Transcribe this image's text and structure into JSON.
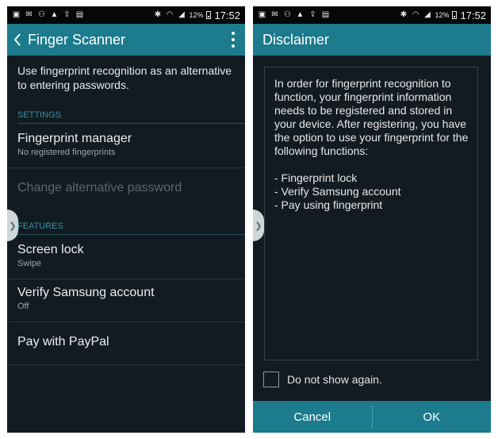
{
  "status_bar": {
    "battery": "12%",
    "time": "17:52",
    "left_icons": [
      "gallery-icon",
      "mail-icon",
      "voicemail-icon",
      "warning-icon",
      "upload-icon",
      "sim-icon"
    ],
    "right_icons": [
      "bluetooth-icon",
      "wifi-icon",
      "signal-icon",
      "battery-icon"
    ]
  },
  "left_screen": {
    "title": "Finger Scanner",
    "intro": "Use fingerprint recognition as an alternative to entering passwords.",
    "sections": [
      {
        "header": "SETTINGS"
      },
      {
        "header": "FEATURES"
      }
    ],
    "settings": [
      {
        "title": "Fingerprint manager",
        "subtitle": "No registered fingerprints"
      },
      {
        "title": "Change alternative password",
        "subtitle": ""
      }
    ],
    "features": [
      {
        "title": "Screen lock",
        "subtitle": "Swipe"
      },
      {
        "title": "Verify Samsung account",
        "subtitle": "Off"
      },
      {
        "title": "Pay with PayPal",
        "subtitle": ""
      }
    ]
  },
  "right_screen": {
    "title": "Disclaimer",
    "paragraph": "In order for fingerprint recognition to function, your fingerprint information needs to be registered and stored in your device. After registering, you have the option to use your fingerprint for the following functions:",
    "list": [
      "- Fingerprint lock",
      "- Verify Samsung account",
      "- Pay using fingerprint"
    ],
    "checkbox_label": "Do not show again.",
    "checkbox_checked": false,
    "cancel_label": "Cancel",
    "ok_label": "OK"
  },
  "colors": {
    "accent": "#1c7b8c",
    "background": "#131b22",
    "section_header": "#3a8fa0"
  }
}
